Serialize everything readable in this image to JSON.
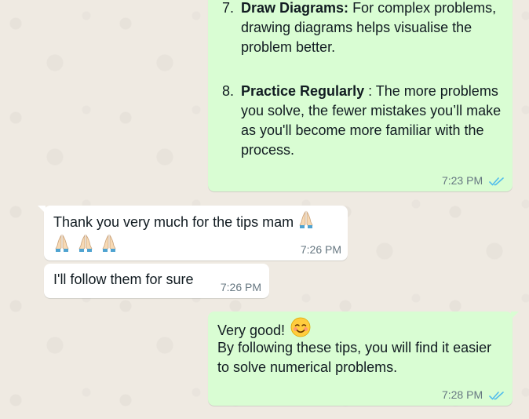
{
  "messages": {
    "tips_message": {
      "item7": {
        "number": "7.",
        "title": "Draw Diagrams:",
        "text": " For complex problems, drawing diagrams helps visualise the problem better."
      },
      "item8": {
        "number": "8.",
        "title": "Practice Regularly",
        "text": " : The more problems you solve, the fewer mistakes you’ll make as you'll become more familiar with the process."
      },
      "time": "7:23 PM",
      "status_icon": "double-check-read-icon"
    },
    "thanks_message": {
      "text": "Thank you very much for the tips mam",
      "emoji_icon": "folded-hands-emoji",
      "emoji_count": 4,
      "time": "7:26 PM"
    },
    "follow_message": {
      "text": "I'll follow them for sure",
      "time": "7:26 PM"
    },
    "reply_message": {
      "line1": "Very good!",
      "emoji_icon": "smiling-face-emoji",
      "text": "By following these tips, you will find it easier to solve numerical problems.",
      "time": "7:28 PM",
      "status_icon": "double-check-read-icon"
    }
  },
  "colors": {
    "outgoing_bubble": "#d9fdd3",
    "incoming_bubble": "#ffffff",
    "wallpaper": "#efeae2",
    "read_ticks": "#53bdeb",
    "timestamp": "#667781"
  }
}
